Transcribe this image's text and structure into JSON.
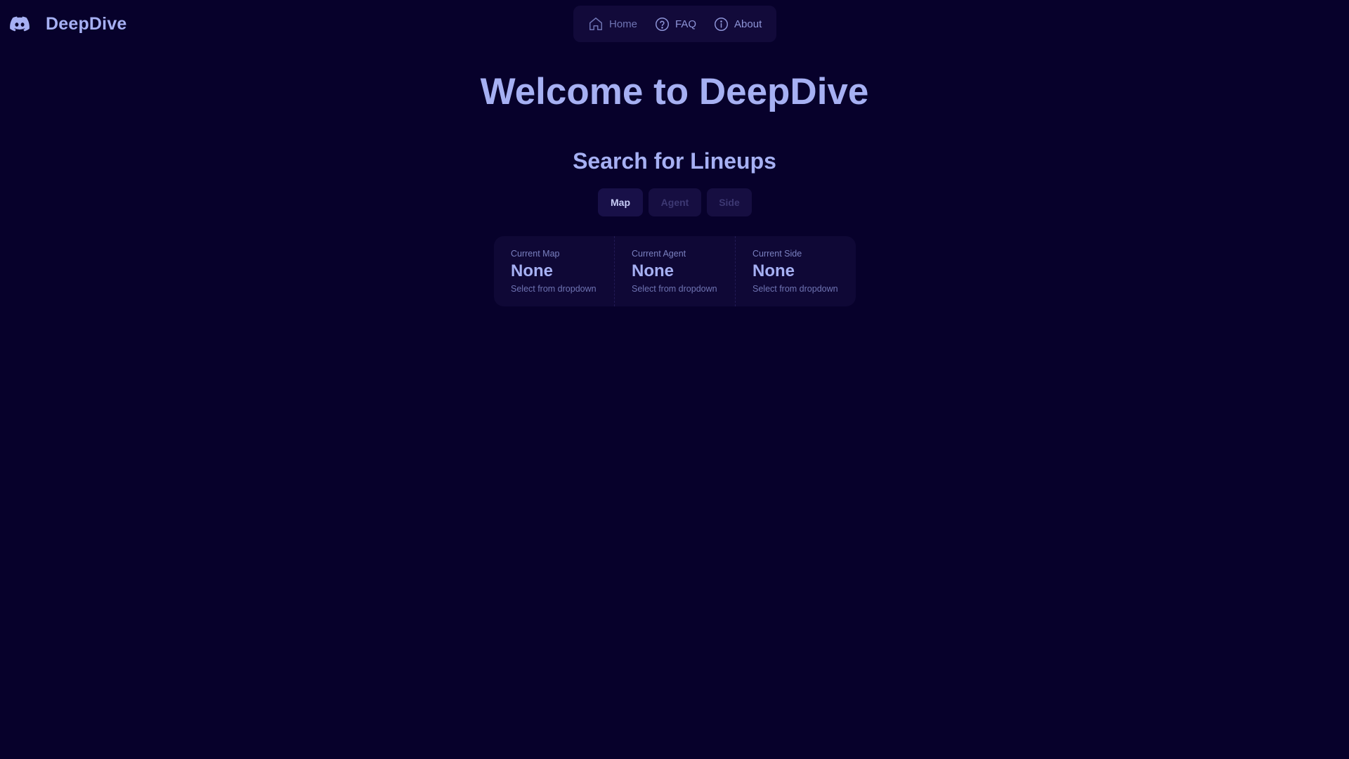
{
  "brand": {
    "logo_icon": "discord-icon",
    "name": "DeepDive"
  },
  "nav": {
    "items": [
      {
        "icon": "home-icon",
        "label": "Home"
      },
      {
        "icon": "question-circle-icon",
        "label": "FAQ"
      },
      {
        "icon": "info-circle-icon",
        "label": "About"
      }
    ]
  },
  "hero": {
    "title": "Welcome to DeepDive"
  },
  "search": {
    "heading": "Search for Lineups",
    "filters": [
      {
        "label": "Map",
        "state": "active"
      },
      {
        "label": "Agent",
        "state": "disabled"
      },
      {
        "label": "Side",
        "state": "disabled"
      }
    ]
  },
  "stats": [
    {
      "title": "Current Map",
      "value": "None",
      "description": "Select from dropdown"
    },
    {
      "title": "Current Agent",
      "value": "None",
      "description": "Select from dropdown"
    },
    {
      "title": "Current Side",
      "value": "None",
      "description": "Select from dropdown"
    }
  ],
  "colors": {
    "background": "#07012b",
    "accent": "#a6b0f3",
    "panel": "#120a3a"
  }
}
